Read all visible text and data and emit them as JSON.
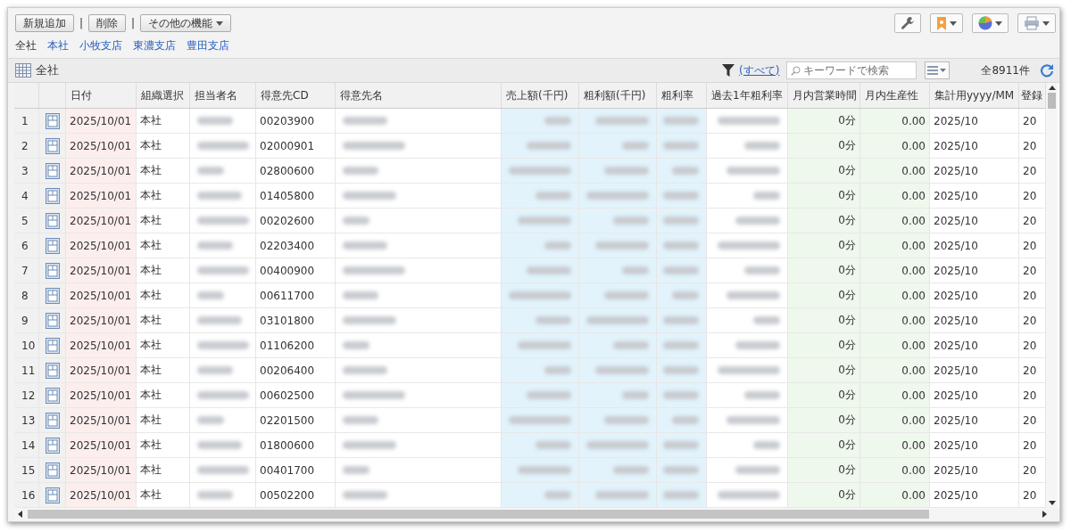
{
  "toolbar": {
    "buttons": [
      {
        "label": "新規追加",
        "kind": "plain"
      },
      {
        "label": "削除",
        "kind": "plain"
      },
      {
        "label": "その他の機能",
        "kind": "menu"
      }
    ],
    "separators": [
      "|",
      "|"
    ]
  },
  "branches": [
    {
      "label": "全社",
      "selected": true
    },
    {
      "label": "本社",
      "selected": false
    },
    {
      "label": "小牧支店",
      "selected": false
    },
    {
      "label": "東濃支店",
      "selected": false
    },
    {
      "label": "豊田支店",
      "selected": false
    }
  ],
  "view": {
    "title": "全社",
    "filter_link": "(すべて)",
    "search": {
      "placeholder": "キーワードで検索"
    },
    "count": "全8911件"
  },
  "table": {
    "columns": [
      {
        "kind": "text",
        "label": "日付",
        "color": "#fdeeee"
      },
      {
        "kind": "text",
        "label": "組織選択"
      },
      {
        "kind": "text",
        "label": "担当者名"
      },
      {
        "kind": "text",
        "label": "得意先CD"
      },
      {
        "kind": "text",
        "label": "得意先名"
      },
      {
        "kind": "number",
        "label": "売上額(千円)",
        "color": "#e2f3fb"
      },
      {
        "kind": "number",
        "label": "粗利額(千円)",
        "color": "#e2f3fb"
      },
      {
        "kind": "number",
        "label": "粗利率",
        "color": "#e2f3fb"
      },
      {
        "kind": "number",
        "label": "過去1年粗利率"
      },
      {
        "kind": "number",
        "label": "月内営業時間",
        "color": "#eef8ec"
      },
      {
        "kind": "number",
        "label": "月内生産性",
        "color": "#eef8ec"
      },
      {
        "kind": "text",
        "label": "集計用yyyy/MM"
      },
      {
        "kind": "text",
        "label": "登録"
      }
    ],
    "rows": [
      {
        "no": "1",
        "cells": [
          "2025/10/01",
          "本社",
          null,
          "00203900",
          null,
          null,
          null,
          null,
          null,
          "0分",
          "0.00",
          "2025/10",
          "20"
        ]
      },
      {
        "no": "2",
        "cells": [
          "2025/10/01",
          "本社",
          null,
          "02000901",
          null,
          null,
          null,
          null,
          null,
          "0分",
          "0.00",
          "2025/10",
          "20"
        ]
      },
      {
        "no": "3",
        "cells": [
          "2025/10/01",
          "本社",
          null,
          "02800600",
          null,
          null,
          null,
          null,
          null,
          "0分",
          "0.00",
          "2025/10",
          "20"
        ]
      },
      {
        "no": "4",
        "cells": [
          "2025/10/01",
          "本社",
          null,
          "01405800",
          null,
          null,
          null,
          null,
          null,
          "0分",
          "0.00",
          "2025/10",
          "20"
        ]
      },
      {
        "no": "5",
        "cells": [
          "2025/10/01",
          "本社",
          null,
          "00202600",
          null,
          null,
          null,
          null,
          null,
          "0分",
          "0.00",
          "2025/10",
          "20"
        ]
      },
      {
        "no": "6",
        "cells": [
          "2025/10/01",
          "本社",
          null,
          "02203400",
          null,
          null,
          null,
          null,
          null,
          "0分",
          "0.00",
          "2025/10",
          "20"
        ]
      },
      {
        "no": "7",
        "cells": [
          "2025/10/01",
          "本社",
          null,
          "00400900",
          null,
          null,
          null,
          null,
          null,
          "0分",
          "0.00",
          "2025/10",
          "20"
        ]
      },
      {
        "no": "8",
        "cells": [
          "2025/10/01",
          "本社",
          null,
          "00611700",
          null,
          null,
          null,
          null,
          null,
          "0分",
          "0.00",
          "2025/10",
          "20"
        ]
      },
      {
        "no": "9",
        "cells": [
          "2025/10/01",
          "本社",
          null,
          "03101800",
          null,
          null,
          null,
          null,
          null,
          "0分",
          "0.00",
          "2025/10",
          "20"
        ]
      },
      {
        "no": "10",
        "cells": [
          "2025/10/01",
          "本社",
          null,
          "01106200",
          null,
          null,
          null,
          null,
          null,
          "0分",
          "0.00",
          "2025/10",
          "20"
        ]
      },
      {
        "no": "11",
        "cells": [
          "2025/10/01",
          "本社",
          null,
          "00206400",
          null,
          null,
          null,
          null,
          null,
          "0分",
          "0.00",
          "2025/10",
          "20"
        ]
      },
      {
        "no": "12",
        "cells": [
          "2025/10/01",
          "本社",
          null,
          "00602500",
          null,
          null,
          null,
          null,
          null,
          "0分",
          "0.00",
          "2025/10",
          "20"
        ]
      },
      {
        "no": "13",
        "cells": [
          "2025/10/01",
          "本社",
          null,
          "02201500",
          null,
          null,
          null,
          null,
          null,
          "0分",
          "0.00",
          "2025/10",
          "20"
        ]
      },
      {
        "no": "14",
        "cells": [
          "2025/10/01",
          "本社",
          null,
          "01800600",
          null,
          null,
          null,
          null,
          null,
          "0分",
          "0.00",
          "2025/10",
          "20"
        ]
      },
      {
        "no": "15",
        "cells": [
          "2025/10/01",
          "本社",
          null,
          "00401700",
          null,
          null,
          null,
          null,
          null,
          "0分",
          "0.00",
          "2025/10",
          "20"
        ]
      },
      {
        "no": "16",
        "cells": [
          "2025/10/01",
          "本社",
          null,
          "00502200",
          null,
          null,
          null,
          null,
          null,
          "0分",
          "0.00",
          "2025/10",
          "20"
        ]
      }
    ]
  }
}
